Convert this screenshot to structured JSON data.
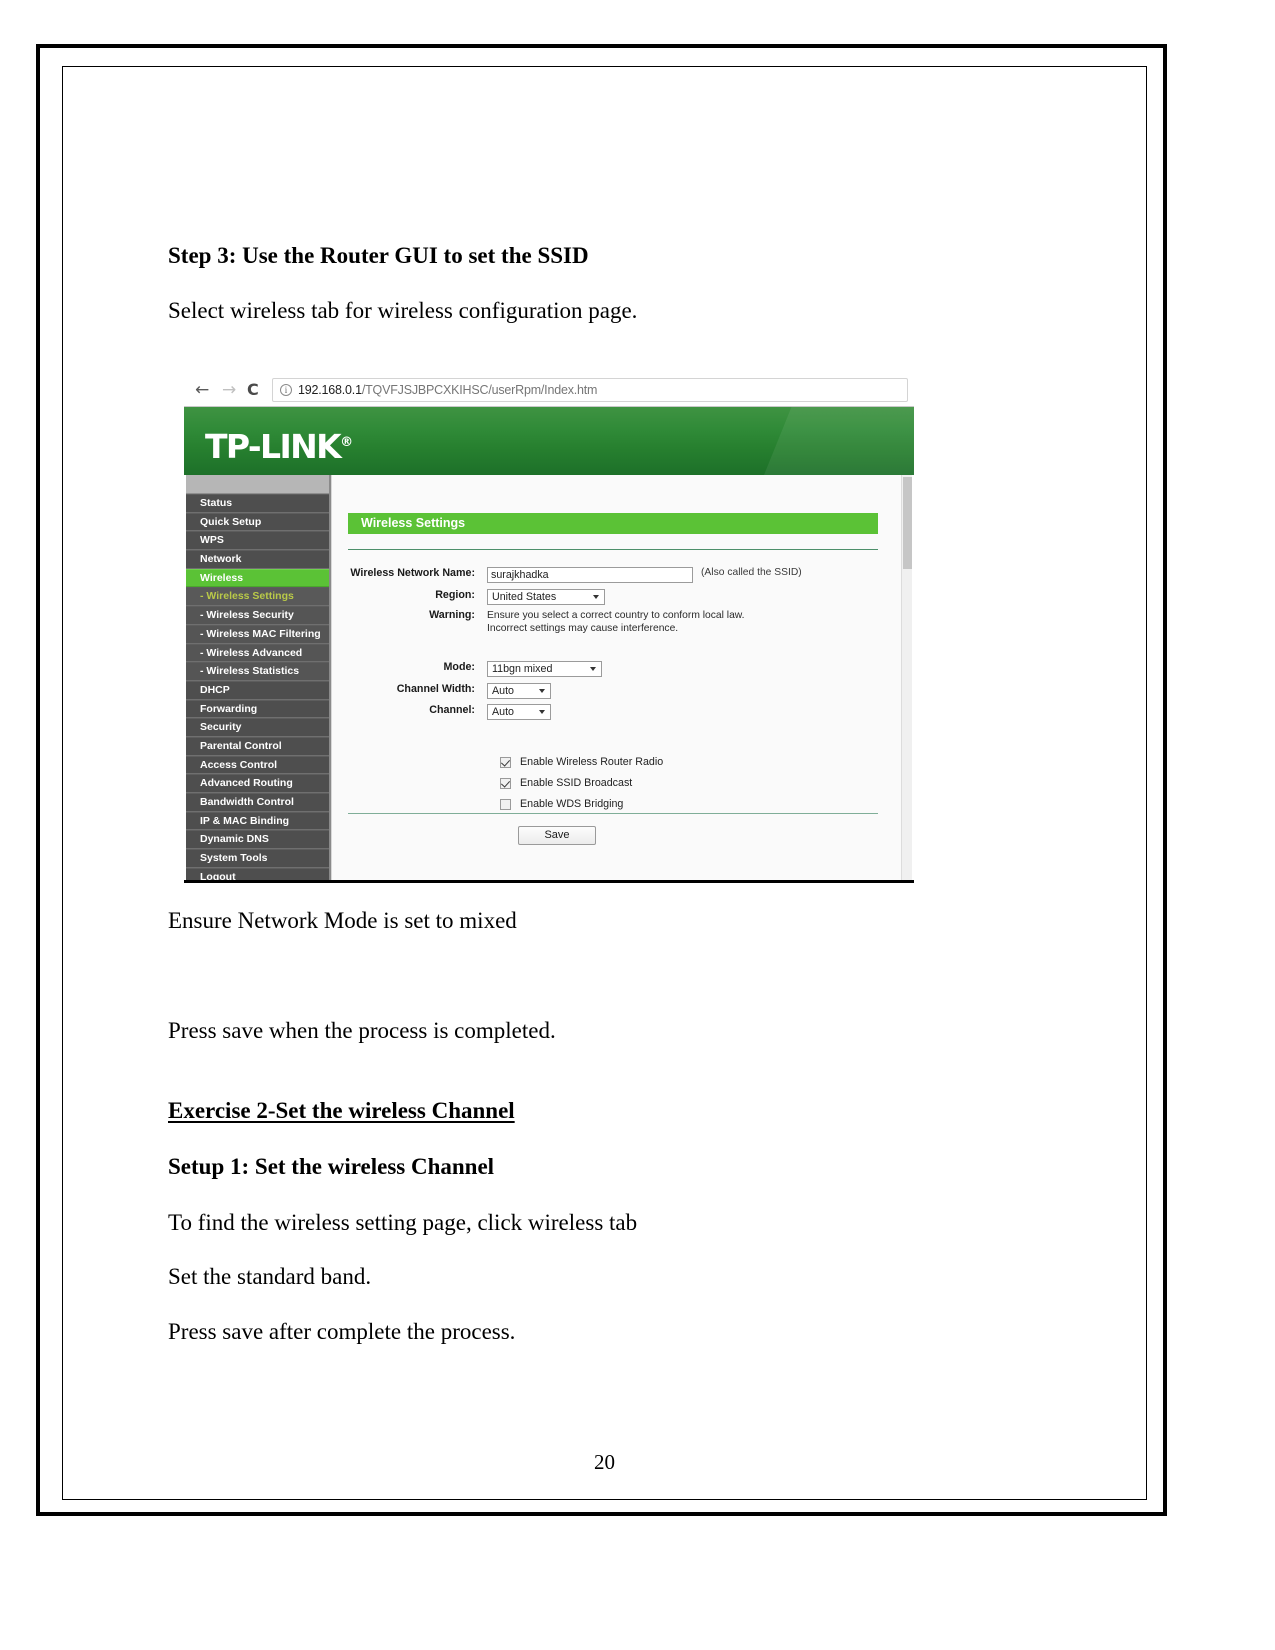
{
  "document": {
    "page_number": "20",
    "blocks": [
      {
        "text": "Step 3: Use the Router GUI to set the SSID",
        "style": "bold"
      },
      {
        "text": "Select wireless tab for wireless configuration page.",
        "style": "normal"
      },
      {
        "text": "Ensure Network Mode is set to mixed",
        "style": "normal"
      },
      {
        "text": "Press save when the process is completed.",
        "style": "normal"
      },
      {
        "text": "Exercise 2-Set the wireless Channel ",
        "style": "underline-bold"
      },
      {
        "text": "Setup 1: Set the wireless Channel",
        "style": "bold"
      },
      {
        "text": "To find the wireless setting page, click wireless tab",
        "style": "normal"
      },
      {
        "text": "Set the standard band.",
        "style": "normal"
      },
      {
        "text": "Press save after complete the process.",
        "style": "normal"
      }
    ]
  },
  "screenshot": {
    "browser": {
      "back_icon": "←",
      "forward_icon": "→",
      "reload_icon": "C",
      "info_icon": "i",
      "url_host": "192.168.0.1",
      "url_path": "/TQVFJSJBPCXKIHSC/userRpm/Index.htm"
    },
    "brand": {
      "logo_text": "TP-LINK",
      "logo_mark": "®",
      "header_color": "#2f8a37"
    },
    "sidebar": {
      "active_color": "#5bc236",
      "subactive_text_color": "#b9c948",
      "items": [
        {
          "label": "Status",
          "state": "normal"
        },
        {
          "label": "Quick Setup",
          "state": "normal"
        },
        {
          "label": "WPS",
          "state": "normal"
        },
        {
          "label": "Network",
          "state": "normal"
        },
        {
          "label": "Wireless",
          "state": "active"
        },
        {
          "label": "- Wireless Settings",
          "state": "subactive"
        },
        {
          "label": "- Wireless Security",
          "state": "sub"
        },
        {
          "label": "- Wireless MAC Filtering",
          "state": "sub"
        },
        {
          "label": "- Wireless Advanced",
          "state": "sub"
        },
        {
          "label": "- Wireless Statistics",
          "state": "sub"
        },
        {
          "label": "DHCP",
          "state": "normal"
        },
        {
          "label": "Forwarding",
          "state": "normal"
        },
        {
          "label": "Security",
          "state": "normal"
        },
        {
          "label": "Parental Control",
          "state": "normal"
        },
        {
          "label": "Access Control",
          "state": "normal"
        },
        {
          "label": "Advanced Routing",
          "state": "normal"
        },
        {
          "label": "Bandwidth Control",
          "state": "normal"
        },
        {
          "label": "IP & MAC Binding",
          "state": "normal"
        },
        {
          "label": "Dynamic DNS",
          "state": "normal"
        },
        {
          "label": "System Tools",
          "state": "normal"
        },
        {
          "label": "Logout",
          "state": "normal"
        }
      ]
    },
    "panel": {
      "title": "Wireless Settings",
      "fields": {
        "ssid_label": "Wireless Network Name:",
        "ssid_value": "surajkhadka",
        "ssid_hint": "(Also called the SSID)",
        "region_label": "Region:",
        "region_value": "United States",
        "warning_label": "Warning:",
        "warning_line1": "Ensure you select a correct country to conform local law.",
        "warning_line2": "Incorrect settings may cause interference.",
        "mode_label": "Mode:",
        "mode_value": "11bgn mixed",
        "channel_width_label": "Channel Width:",
        "channel_width_value": "Auto",
        "channel_label": "Channel:",
        "channel_value": "Auto"
      },
      "checkboxes": [
        {
          "label": "Enable Wireless Router Radio",
          "checked": true
        },
        {
          "label": "Enable SSID Broadcast",
          "checked": true
        },
        {
          "label": "Enable WDS Bridging",
          "checked": false
        }
      ],
      "save_label": "Save"
    }
  }
}
